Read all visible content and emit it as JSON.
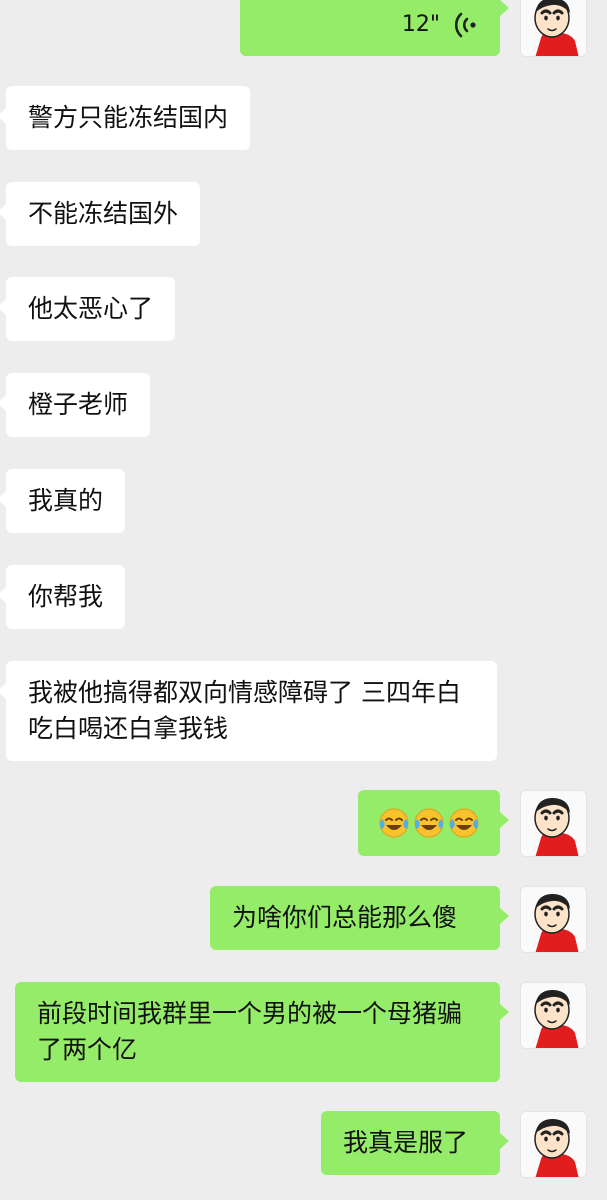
{
  "messages": [
    {
      "id": "m0",
      "side": "out",
      "type": "voice",
      "duration": "12\""
    },
    {
      "id": "m1",
      "side": "in",
      "text": "警方只能冻结国内"
    },
    {
      "id": "m2",
      "side": "in",
      "text": "不能冻结国外"
    },
    {
      "id": "m3",
      "side": "in",
      "text": "他太恶心了"
    },
    {
      "id": "m4",
      "side": "in",
      "text": "橙子老师"
    },
    {
      "id": "m5",
      "side": "in",
      "text": "我真的"
    },
    {
      "id": "m6",
      "side": "in",
      "text": "你帮我"
    },
    {
      "id": "m7",
      "side": "in",
      "text": "我被他搞得都双向情感障碍了 三四年白吃白喝还白拿我钱"
    },
    {
      "id": "m8",
      "side": "out",
      "type": "emoji",
      "emojis": [
        "face-with-tears-of-joy-icon",
        "face-with-tears-of-joy-icon",
        "face-with-tears-of-joy-icon"
      ]
    },
    {
      "id": "m9",
      "side": "out",
      "text": "为啥你们总能那么傻"
    },
    {
      "id": "m10",
      "side": "out",
      "text": "前段时间我群里一个男的被一个母猪骗了两个亿"
    },
    {
      "id": "m11",
      "side": "out",
      "text": "我真是服了"
    }
  ],
  "colors": {
    "background": "#ededed",
    "incoming_bubble": "#ffffff",
    "outgoing_bubble": "#95ec69",
    "text": "#111111"
  }
}
